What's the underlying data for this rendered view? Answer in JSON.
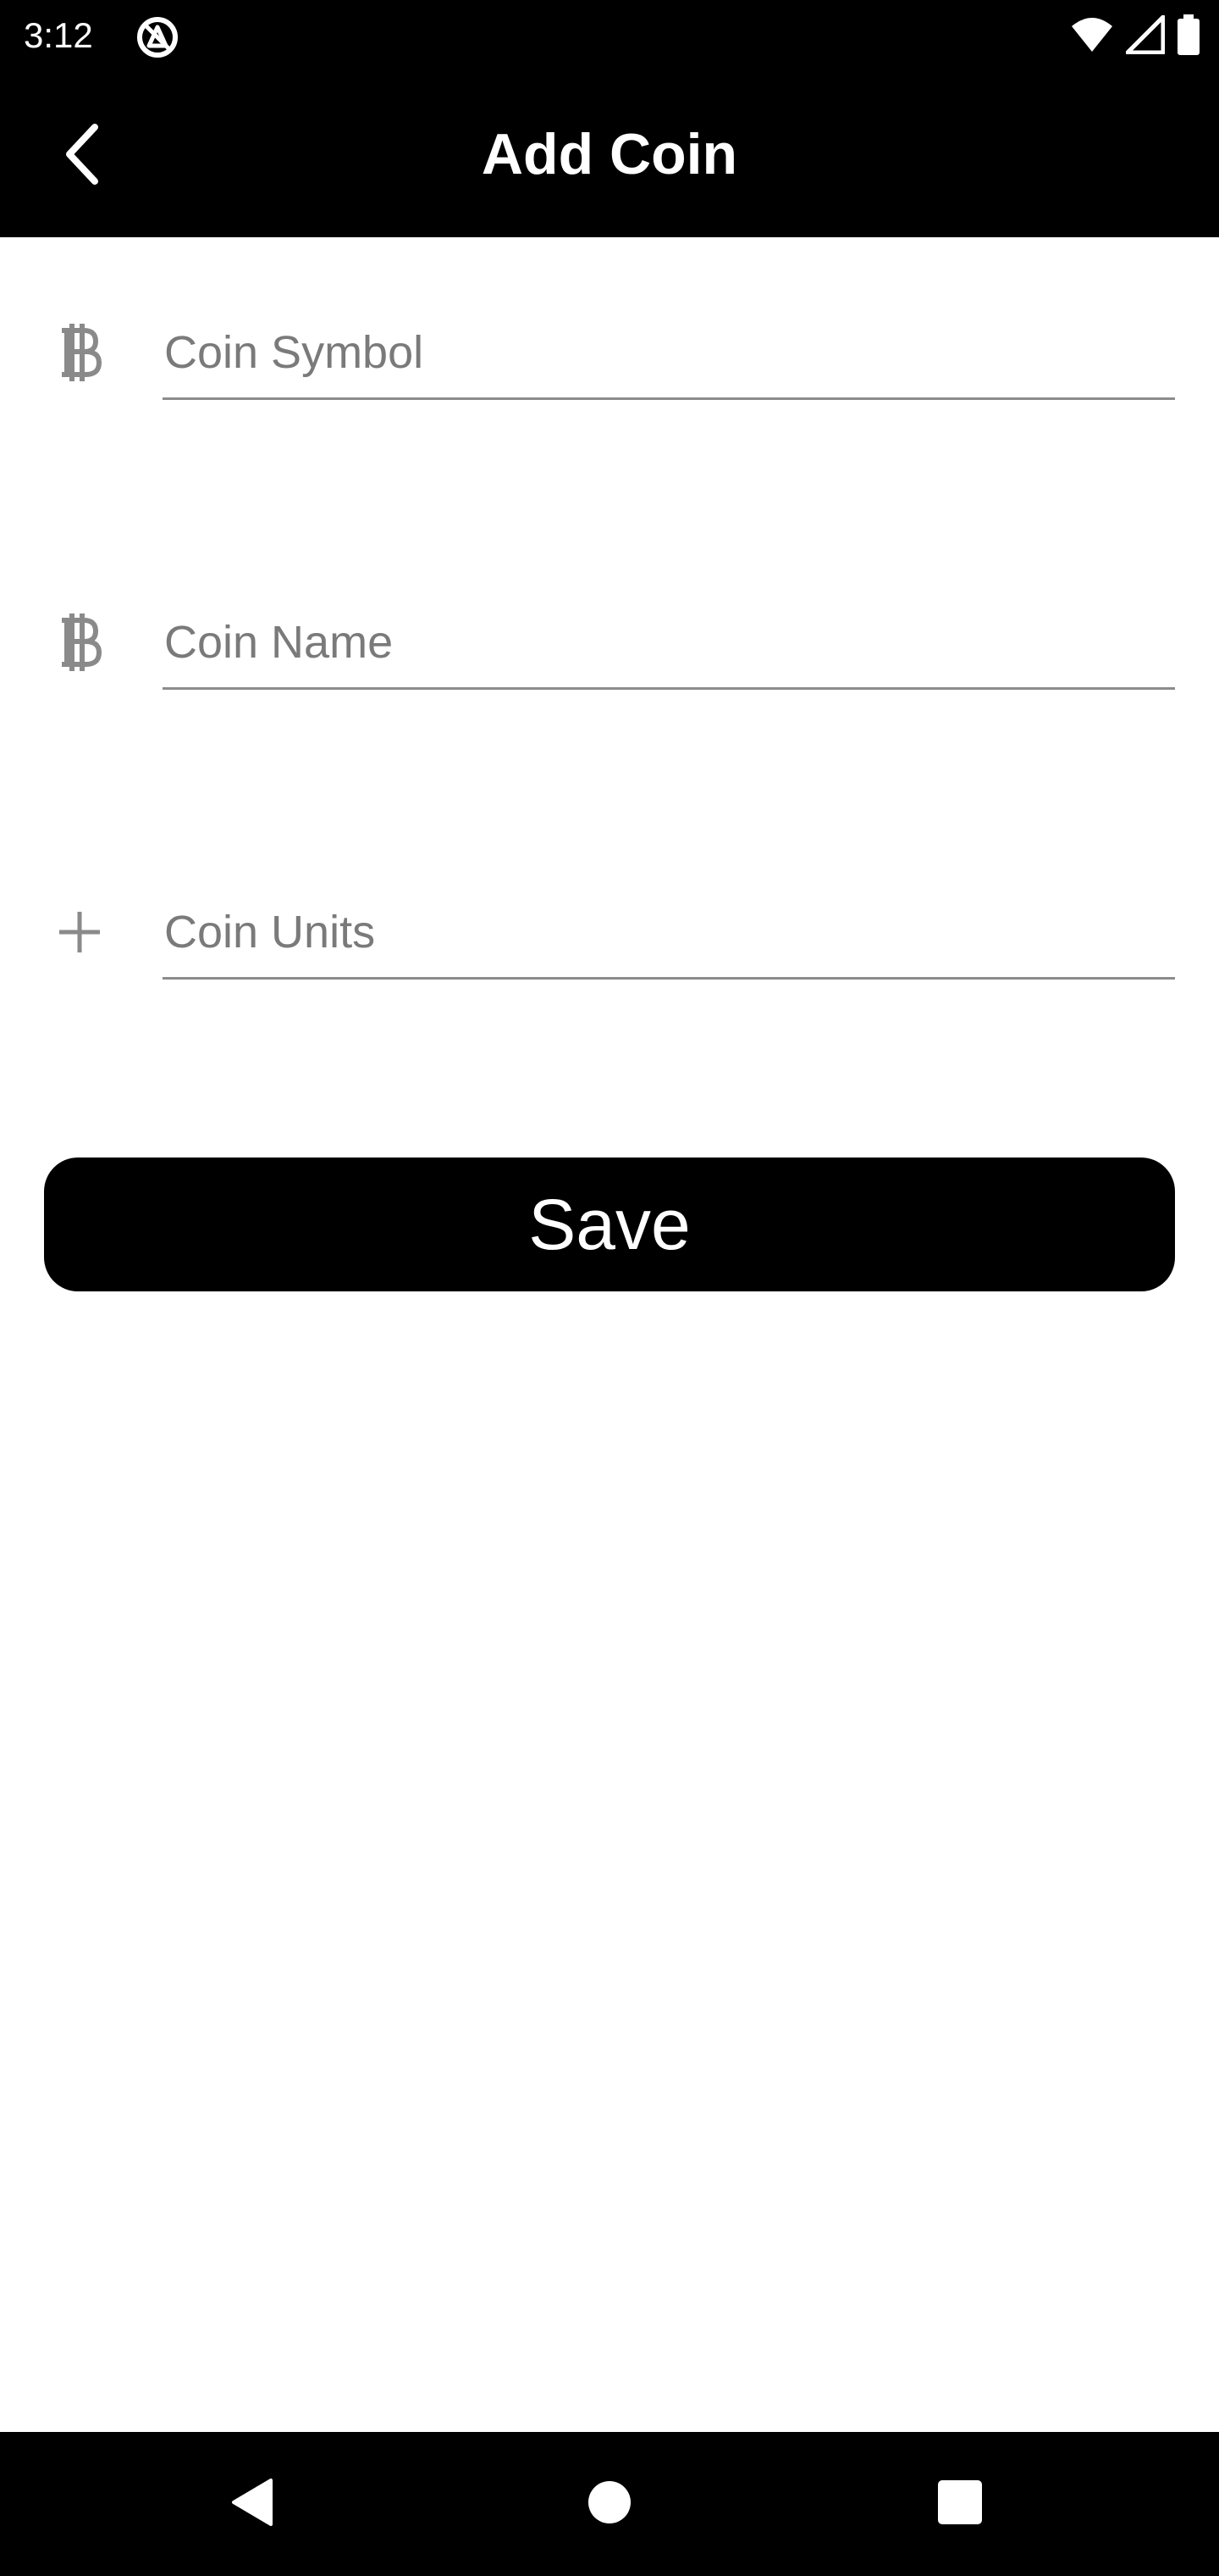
{
  "status_bar": {
    "time": "3:12",
    "app_icon": "blocked-notification-icon",
    "icons": [
      "wifi-icon",
      "signal-icon",
      "battery-icon"
    ]
  },
  "app_bar": {
    "title": "Add Coin",
    "back_icon": "chevron-left-icon"
  },
  "form": {
    "fields": [
      {
        "icon": "bitcoin-icon",
        "placeholder": "Coin Symbol",
        "value": ""
      },
      {
        "icon": "bitcoin-icon",
        "placeholder": "Coin Name",
        "value": ""
      },
      {
        "icon": "plus-icon",
        "placeholder": "Coin Units",
        "value": ""
      }
    ],
    "save_label": "Save"
  },
  "nav_bar": {
    "buttons": [
      "back-triangle-icon",
      "home-circle-icon",
      "recents-square-icon"
    ]
  },
  "colors": {
    "bar_background": "#000000",
    "page_background": "#ffffff",
    "icon_gray": "#8a8a8a",
    "underline_gray": "#8c8c8c",
    "button_background": "#000000",
    "button_text": "#ffffff"
  }
}
